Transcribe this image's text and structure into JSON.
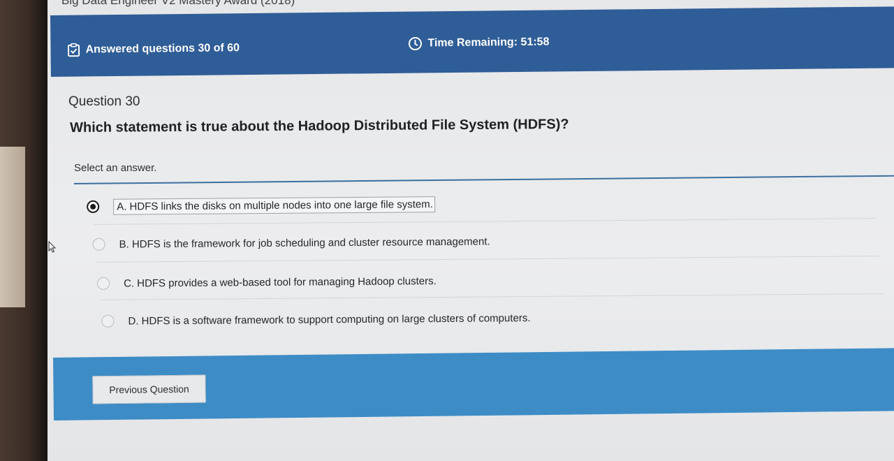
{
  "page": {
    "title": "Big Data Engineer V2 Mastery Award (2018)"
  },
  "header": {
    "answered_text": "Answered questions 30 of 60",
    "answered_icon": "clipboard-check-icon",
    "timer_text": "Time Remaining: 51:58",
    "timer_icon": "clock-icon",
    "background_color": "#2f5d97"
  },
  "question": {
    "number_label": "Question 30",
    "text": "Which statement is true about the Hadoop Distributed File System (HDFS)?",
    "instruction": "Select an answer.",
    "options": [
      {
        "label": "A. HDFS links the disks on multiple nodes into one large file system.",
        "selected": true
      },
      {
        "label": "B. HDFS is the framework for job scheduling and cluster resource management.",
        "selected": false
      },
      {
        "label": "C. HDFS provides a web-based tool for managing Hadoop clusters.",
        "selected": false
      },
      {
        "label": "D. HDFS is a software framework to support computing on large clusters of computers.",
        "selected": false
      }
    ]
  },
  "footer": {
    "previous_label": "Previous Question",
    "background_color": "#3d8cc6"
  }
}
